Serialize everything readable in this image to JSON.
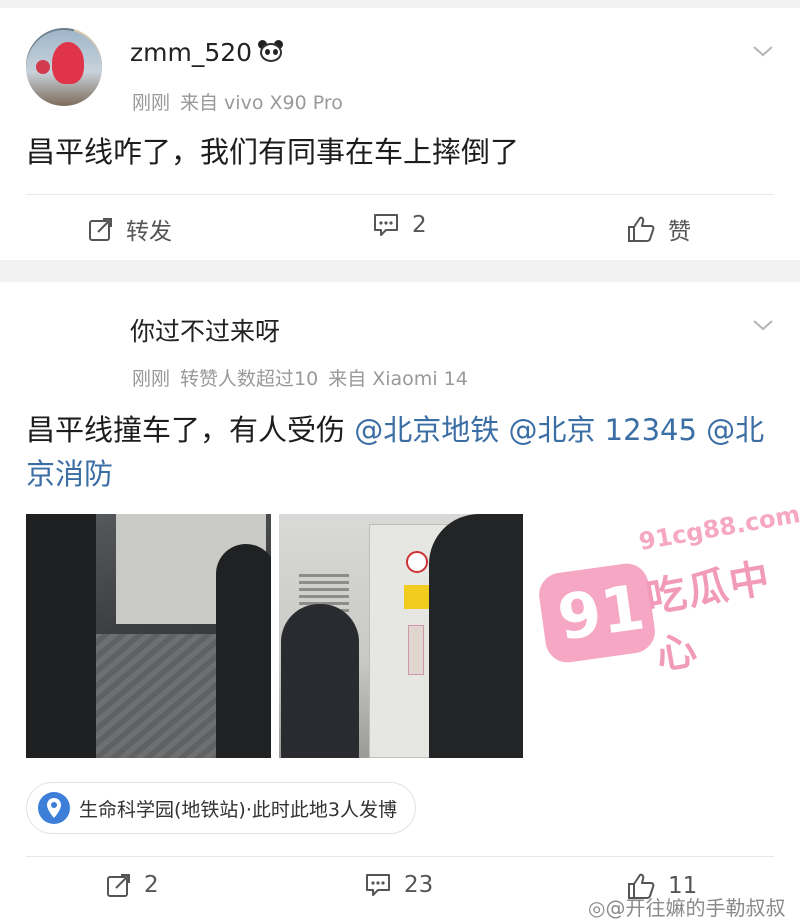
{
  "post1": {
    "username": "zmm_520",
    "time": "刚刚",
    "source": "来自 vivo X90 Pro",
    "text": "昌平线咋了，我们有同事在车上摔倒了",
    "actions": {
      "forward": "转发",
      "comments": "2",
      "like": "赞"
    }
  },
  "post2": {
    "username": "你过不过来呀",
    "time": "刚刚",
    "likes_note": "转赞人数超过10",
    "source": "来自 Xiaomi 14",
    "text_main": "昌平线撞车了，有人受伤 ",
    "mention1": "@北京地铁",
    "mention2": "@北京 12345",
    "mention3": "@北京消防",
    "location": "生命科学园(地铁站)·此时此地3人发博",
    "actions": {
      "forward": "2",
      "comments": "23",
      "like": "11"
    }
  },
  "watermark": {
    "logo_number": "91",
    "url": "91cg88.com",
    "name": "吃瓜中心"
  },
  "credit": "@开往嫲的手勒叔叔",
  "colors": {
    "link": "#3b6ea5",
    "meta": "#999999",
    "watermark_pink": "#f5a7c3",
    "background": "#f2f2f2"
  },
  "icons": [
    "panda-emoji-icon",
    "chevron-down-icon",
    "forward-icon",
    "comment-icon",
    "like-icon",
    "location-pin-icon",
    "weibo-icon"
  ]
}
